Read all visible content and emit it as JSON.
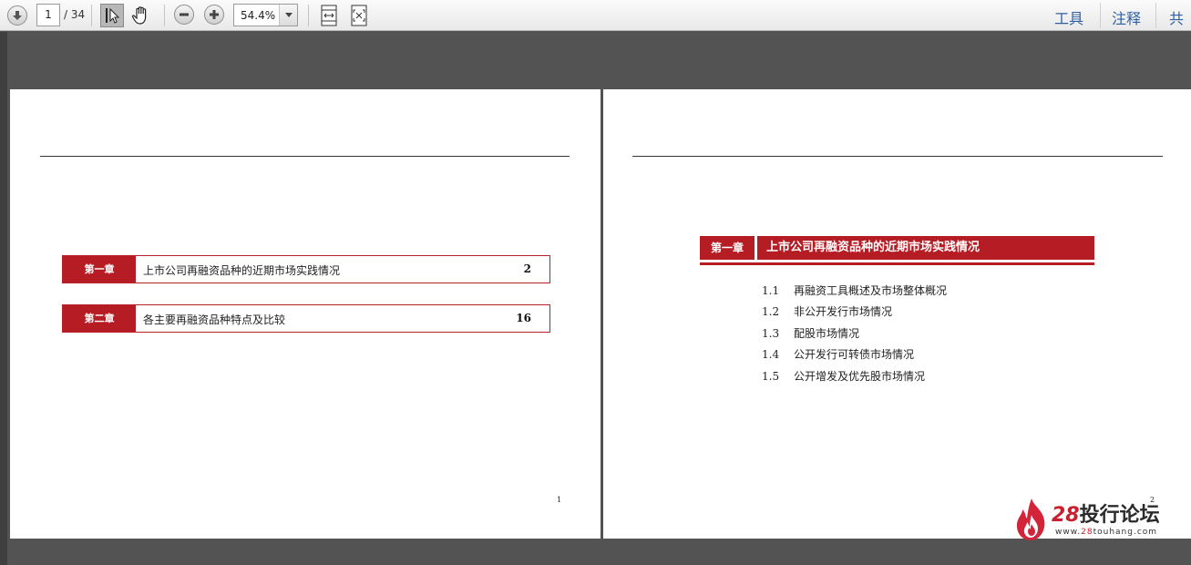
{
  "toolbar": {
    "page_current": "1",
    "page_total": "/ 34",
    "zoom": "54.4%",
    "right_tabs": [
      "工具",
      "注释",
      "共享"
    ]
  },
  "icons": {
    "prev_page": "arrow-down-circle-icon",
    "select_tool": "text-select-cursor-icon",
    "hand_tool": "hand-icon",
    "zoom_out": "minus-circle-icon",
    "zoom_in": "plus-circle-icon",
    "fit_width": "fit-width-icon",
    "fit_page": "fit-page-icon",
    "dropdown": "chevron-down-icon"
  },
  "colors": {
    "accent_red": "#b51c24",
    "link_blue": "#2f5fa4"
  },
  "page1": {
    "toc": [
      {
        "chapter": "第一章",
        "title": "上市公司再融资品种的近期市场实践情况",
        "page": "2"
      },
      {
        "chapter": "第二章",
        "title": "各主要再融资品种特点及比较",
        "page": "16"
      }
    ],
    "page_number": "1"
  },
  "page2": {
    "chapter_label": "第一章",
    "chapter_title": "上市公司再融资品种的近期市场实践情况",
    "sections": [
      {
        "num": "1.1",
        "title": "再融资工具概述及市场整体概况"
      },
      {
        "num": "1.2",
        "title": "非公开发行市场情况"
      },
      {
        "num": "1.3",
        "title": "配股市场情况"
      },
      {
        "num": "1.4",
        "title": "公开发行可转债市场情况"
      },
      {
        "num": "1.5",
        "title": "公开增发及优先股市场情况"
      }
    ],
    "page_number": "2"
  },
  "watermark": {
    "num": "28",
    "name": "投行论坛",
    "url_pre": "www.",
    "url_num": "28",
    "url_post": "touhang.com"
  }
}
